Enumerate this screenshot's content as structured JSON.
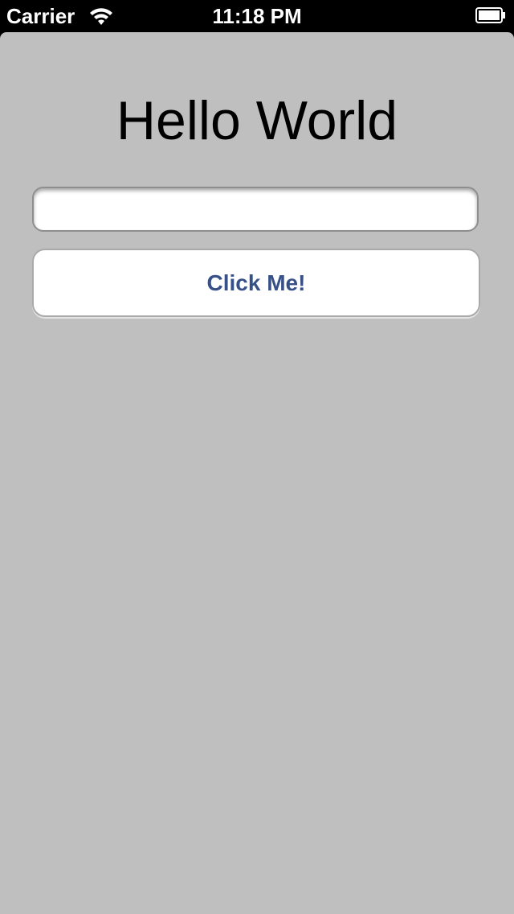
{
  "status_bar": {
    "carrier": "Carrier",
    "time": "11:18 PM",
    "wifi_icon": "wifi-icon",
    "battery_icon": "battery-icon"
  },
  "main": {
    "title": "Hello World",
    "text_field": {
      "value": "",
      "placeholder": ""
    },
    "button_label": "Click Me!"
  },
  "colors": {
    "background": "#bfbfbf",
    "button_text": "#375188",
    "status_bar": "#000000"
  }
}
